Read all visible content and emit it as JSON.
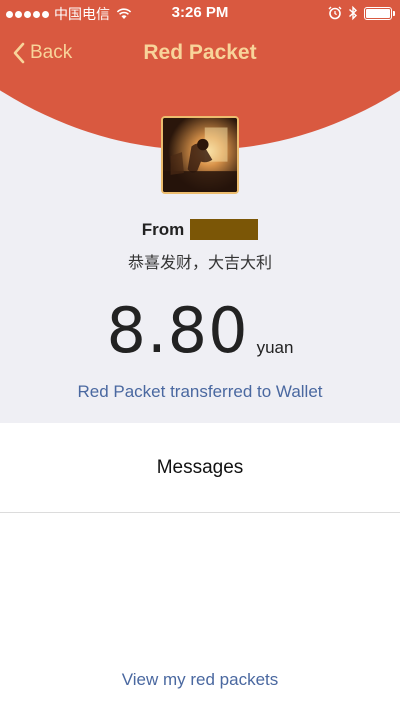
{
  "status_bar": {
    "carrier": "中国电信",
    "time": "3:26 PM",
    "signal_icon": "signal-dots-icon",
    "wifi_icon": "wifi-icon",
    "alarm_icon": "alarm-icon",
    "bluetooth_icon": "bluetooth-icon",
    "battery_icon": "battery-icon"
  },
  "nav": {
    "back_label": "Back",
    "back_icon": "chevron-left-icon",
    "title": "Red Packet"
  },
  "sender": {
    "from_label": "From",
    "wish": "恭喜发财，大吉大利"
  },
  "amount": {
    "value": "8.80",
    "unit": "yuan"
  },
  "wallet_link": "Red Packet transferred to Wallet",
  "messages_label": "Messages",
  "view_link": "View my red packets",
  "colors": {
    "header": "#d95940",
    "header_text": "#f8d49a",
    "link": "#4a68a0",
    "background": "#efeff4"
  }
}
